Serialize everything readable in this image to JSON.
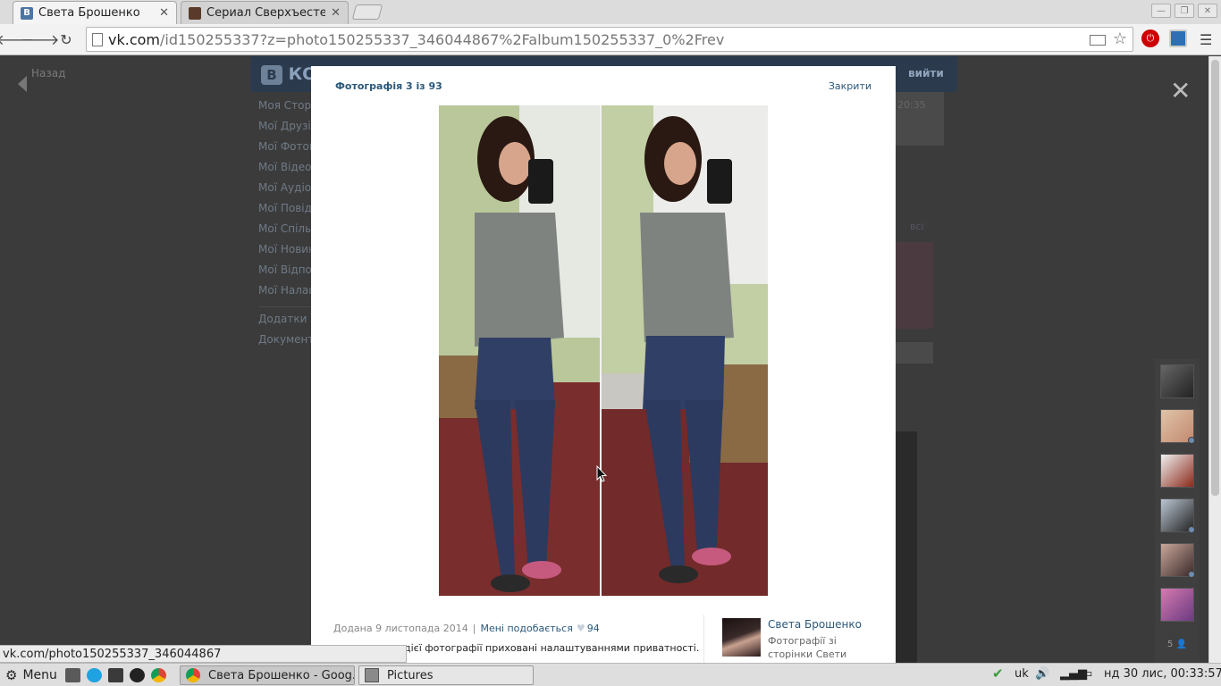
{
  "browser": {
    "tabs": [
      {
        "title": "Света Брошенко",
        "favicon": "vk-icon",
        "active": true
      },
      {
        "title": "Сериал Сверхъестест",
        "favicon": "film-icon",
        "active": false
      }
    ],
    "url_host": "vk.com",
    "url_path": "/id150255337?z=photo150255337_346044867%2Falbum150255337_0%2Frev"
  },
  "vk_page": {
    "logo_letter": "В",
    "logo_text": "КО",
    "exit_label": "вийти",
    "back_label": "Назад",
    "menu": [
      "Моя Сторі",
      "Мої Друзі",
      "Мої Фотог",
      "Мої Відеоз",
      "Мої Аудіоз",
      "Мої Повідо",
      "Мої Спільн",
      "Мої Новин",
      "Мої Відпов",
      "Мої Налаш"
    ],
    "menu_extra": [
      "Додатки",
      "Документи"
    ],
    "bg_time": "20:35",
    "bg_all": "всі"
  },
  "photo_view": {
    "counter": "Фотографія 3 із 93",
    "close_label": "Закрити",
    "added": "Додана 9 листопада 2014",
    "separator": "|",
    "like_label": "Мені подобається",
    "like_count": "94",
    "privacy_note": "дієї фотографії приховані налаштуваннями приватності.",
    "owner_name": "Света Брошенко",
    "owner_album": "Фотографії зі сторінки Свети"
  },
  "chat": {
    "online_count": "5"
  },
  "status_url": "vk.com/photo150255337_346044867",
  "taskbar": {
    "menu_label": "Menu",
    "windows": [
      {
        "title": "Света Брошенко - Goog...",
        "active": true
      },
      {
        "title": "Pictures",
        "active": false
      }
    ],
    "keyboard_layout": "uk",
    "datetime": "нд 30 лис, 00:33:57"
  },
  "colors": {
    "vk_link": "#2b587a",
    "vk_header": "#2b3a4c",
    "overlay": "#3b3b3b"
  }
}
